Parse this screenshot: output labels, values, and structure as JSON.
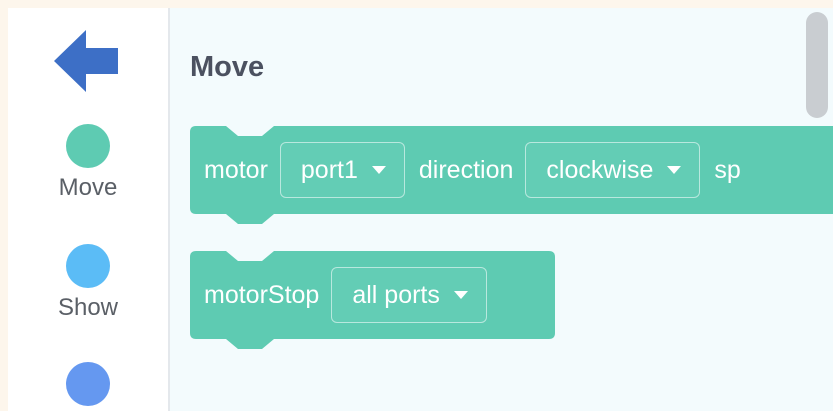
{
  "sidebar": {
    "categories": [
      {
        "label": "Move",
        "color": "#5ecbb2"
      },
      {
        "label": "Show",
        "color": "#5bbcf6"
      },
      {
        "label": "",
        "color": "#6598f0"
      }
    ],
    "back_arrow_color": "#3d6fc6"
  },
  "workspace": {
    "section_title": "Move",
    "block_color": "#5ecbb2",
    "blocks": [
      {
        "name": "motor",
        "text1": "motor",
        "port_value": "port1",
        "text2": "direction",
        "direction_value": "clockwise",
        "text3": "sp"
      },
      {
        "name": "motorStop",
        "text1": "motorStop",
        "port_value": "all ports"
      }
    ]
  }
}
